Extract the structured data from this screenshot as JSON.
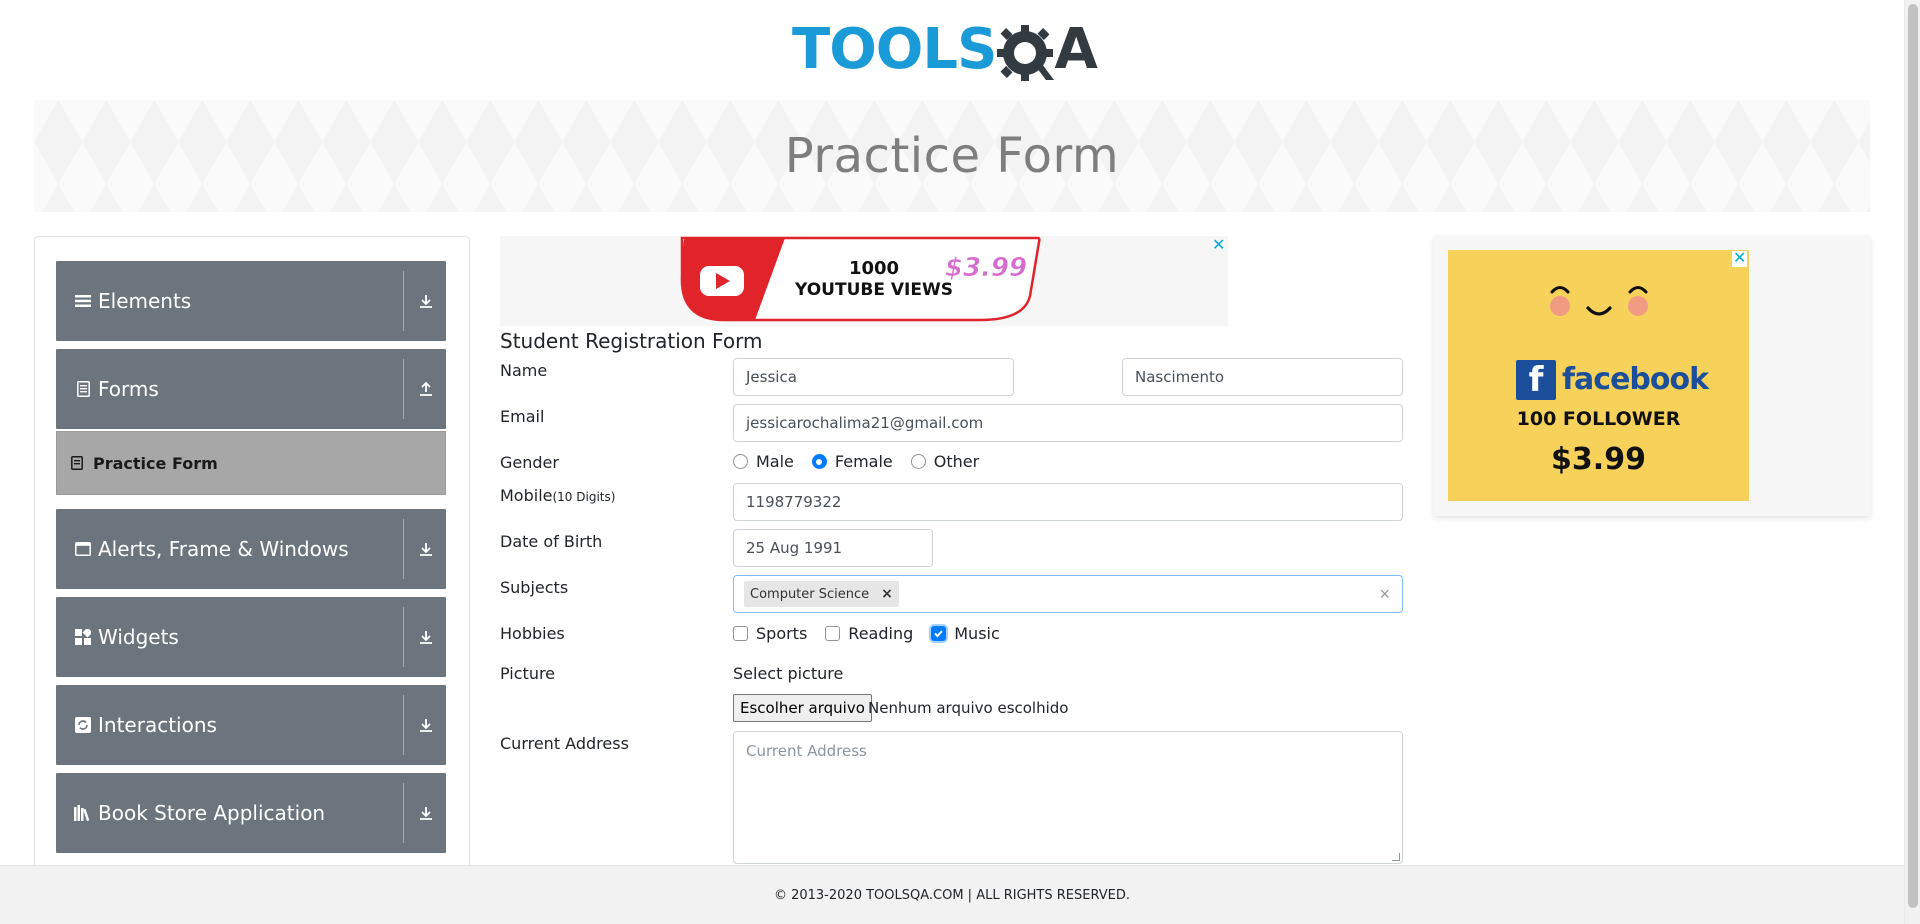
{
  "header": {
    "logo_main": "TOOLS",
    "logo_end": "A",
    "page_title": "Practice Form"
  },
  "sidebar": {
    "groups": [
      {
        "label": "Elements",
        "icon": "menu-icon",
        "arrow": "download-arrow-icon"
      },
      {
        "label": "Forms",
        "icon": "document-icon",
        "arrow": "upload-arrow-icon"
      },
      {
        "label": "Alerts, Frame & Windows",
        "icon": "window-icon",
        "arrow": "download-arrow-icon"
      },
      {
        "label": "Widgets",
        "icon": "widgets-icon",
        "arrow": "download-arrow-icon"
      },
      {
        "label": "Interactions",
        "icon": "interactions-icon",
        "arrow": "download-arrow-icon"
      },
      {
        "label": "Book Store Application",
        "icon": "books-icon",
        "arrow": "download-arrow-icon"
      }
    ],
    "active_item": "Practice Form"
  },
  "ad_top": {
    "line1": "1000",
    "line2": "YOUTUBE VIEWS",
    "price": "$3.99",
    "close": "✕"
  },
  "ad_right": {
    "brand": "facebook",
    "brand_letter": "f",
    "follow": "100 FOLLOWER",
    "price": "$3.99",
    "close": "✕",
    "color_bg": "#f7d25a"
  },
  "form": {
    "title": "Student Registration Form",
    "labels": {
      "name": "Name",
      "email": "Email",
      "gender": "Gender",
      "mobile": "Mobile",
      "mobile_hint": "(10 Digits)",
      "dob": "Date of Birth",
      "subjects": "Subjects",
      "hobbies": "Hobbies",
      "picture": "Picture",
      "address": "Current Address"
    },
    "first_name": "Jessica",
    "last_name": "Nascimento",
    "email": "jessicarochalima21@gmail.com",
    "gender_options": [
      "Male",
      "Female",
      "Other"
    ],
    "gender_selected": "Female",
    "mobile": "1198779322",
    "dob": "25 Aug 1991",
    "subjects": [
      "Computer Science"
    ],
    "subject_remove": "×",
    "subjects_clear": "×",
    "hobbies": [
      "Sports",
      "Reading",
      "Music"
    ],
    "hobbies_checked": [
      "Music"
    ],
    "picture_prompt": "Select picture",
    "file_button": "Escolher arquivo",
    "file_status": "Nenhum arquivo escolhido",
    "address_placeholder": "Current Address"
  },
  "footer": {
    "text": "© 2013-2020 TOOLSQA.COM | ALL RIGHTS RESERVED."
  },
  "colors": {
    "brand_blue": "#1a9bd7",
    "sidebar_bg": "#6c757d",
    "active_bg": "#a7a7a7",
    "accent": "#007bff"
  }
}
